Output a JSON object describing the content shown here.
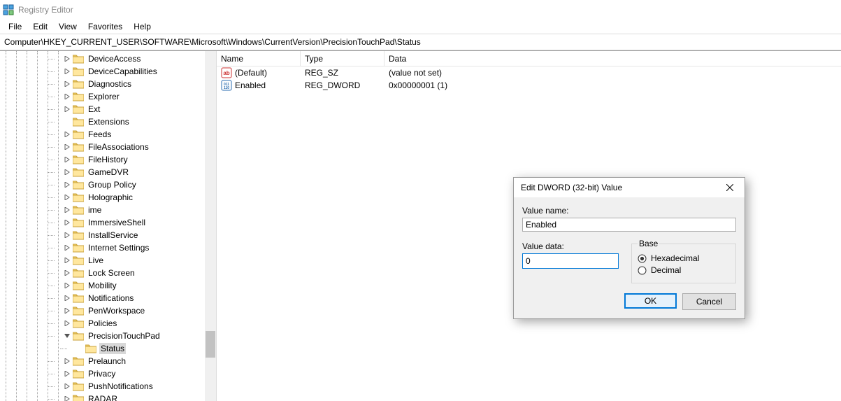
{
  "app": {
    "title": "Registry Editor"
  },
  "menu": {
    "file": "File",
    "edit": "Edit",
    "view": "View",
    "favorites": "Favorites",
    "help": "Help"
  },
  "address": "Computer\\HKEY_CURRENT_USER\\SOFTWARE\\Microsoft\\Windows\\CurrentVersion\\PrecisionTouchPad\\Status",
  "tree_items": [
    {
      "label": "DeviceAccess",
      "expander": ">",
      "indent": 0
    },
    {
      "label": "DeviceCapabilities",
      "expander": ">",
      "indent": 0
    },
    {
      "label": "Diagnostics",
      "expander": ">",
      "indent": 0
    },
    {
      "label": "Explorer",
      "expander": ">",
      "indent": 0
    },
    {
      "label": "Ext",
      "expander": ">",
      "indent": 0
    },
    {
      "label": "Extensions",
      "expander": "",
      "indent": 0
    },
    {
      "label": "Feeds",
      "expander": ">",
      "indent": 0
    },
    {
      "label": "FileAssociations",
      "expander": ">",
      "indent": 0
    },
    {
      "label": "FileHistory",
      "expander": ">",
      "indent": 0
    },
    {
      "label": "GameDVR",
      "expander": ">",
      "indent": 0
    },
    {
      "label": "Group Policy",
      "expander": ">",
      "indent": 0
    },
    {
      "label": "Holographic",
      "expander": ">",
      "indent": 0
    },
    {
      "label": "ime",
      "expander": ">",
      "indent": 0
    },
    {
      "label": "ImmersiveShell",
      "expander": ">",
      "indent": 0
    },
    {
      "label": "InstallService",
      "expander": ">",
      "indent": 0
    },
    {
      "label": "Internet Settings",
      "expander": ">",
      "indent": 0
    },
    {
      "label": "Live",
      "expander": ">",
      "indent": 0
    },
    {
      "label": "Lock Screen",
      "expander": ">",
      "indent": 0
    },
    {
      "label": "Mobility",
      "expander": ">",
      "indent": 0
    },
    {
      "label": "Notifications",
      "expander": ">",
      "indent": 0
    },
    {
      "label": "PenWorkspace",
      "expander": ">",
      "indent": 0
    },
    {
      "label": "Policies",
      "expander": ">",
      "indent": 0
    },
    {
      "label": "PrecisionTouchPad",
      "expander": "v",
      "indent": 0
    },
    {
      "label": "Status",
      "expander": "",
      "indent": 1,
      "selected": true
    },
    {
      "label": "Prelaunch",
      "expander": ">",
      "indent": 0
    },
    {
      "label": "Privacy",
      "expander": ">",
      "indent": 0
    },
    {
      "label": "PushNotifications",
      "expander": ">",
      "indent": 0
    },
    {
      "label": "RADAR",
      "expander": ">",
      "indent": 0
    }
  ],
  "list": {
    "columns": {
      "name": "Name",
      "type": "Type",
      "data": "Data"
    },
    "rows": [
      {
        "icon": "sz",
        "name": "(Default)",
        "type": "REG_SZ",
        "data": "(value not set)"
      },
      {
        "icon": "dword",
        "name": "Enabled",
        "type": "REG_DWORD",
        "data": "0x00000001 (1)"
      }
    ]
  },
  "dialog": {
    "title": "Edit DWORD (32-bit) Value",
    "label_value_name": "Value name:",
    "value_name": "Enabled",
    "label_value_data": "Value data:",
    "value_data": "0",
    "group_base": "Base",
    "radio_hex": "Hexadecimal",
    "radio_dec": "Decimal",
    "btn_ok": "OK",
    "btn_cancel": "Cancel"
  }
}
